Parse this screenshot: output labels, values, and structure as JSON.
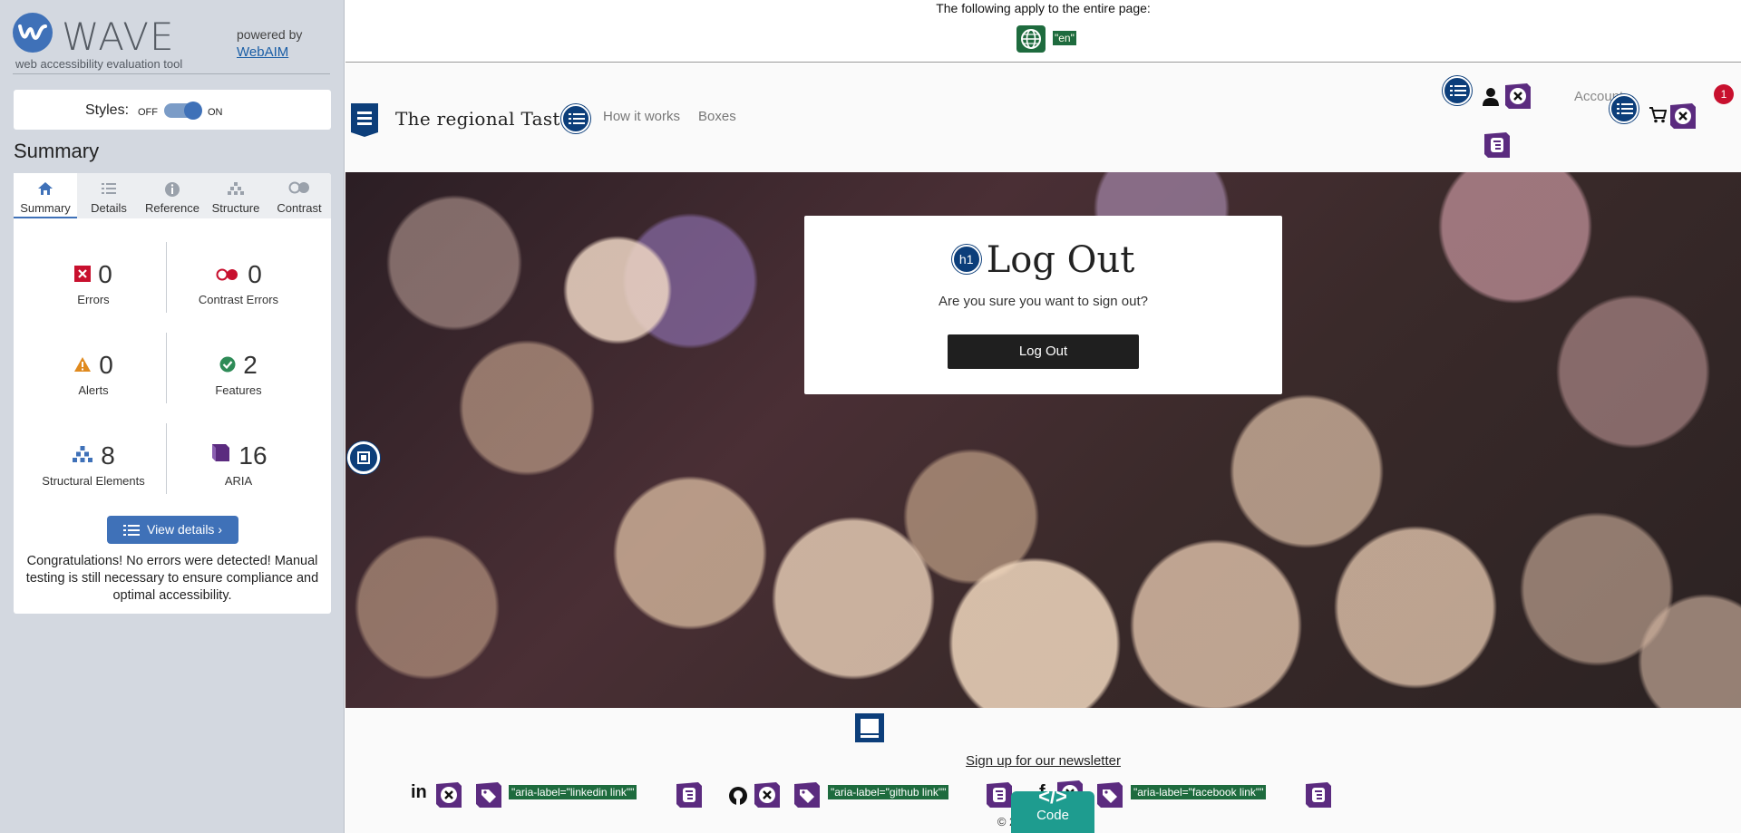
{
  "wave": {
    "brand_name": "WAVE",
    "tagline": "web accessibility evaluation tool",
    "powered_by": "powered by",
    "webaim_link": "WebAIM",
    "styles_label": "Styles:",
    "styles_off": "OFF",
    "styles_on": "ON",
    "summary_heading": "Summary",
    "tabs": [
      "Summary",
      "Details",
      "Reference",
      "Structure",
      "Contrast"
    ],
    "active_tab": "Summary",
    "stats": {
      "errors": {
        "count": "0",
        "label": "Errors"
      },
      "contrast_errors": {
        "count": "0",
        "label": "Contrast Errors"
      },
      "alerts": {
        "count": "0",
        "label": "Alerts"
      },
      "features": {
        "count": "2",
        "label": "Features"
      },
      "structural": {
        "count": "8",
        "label": "Structural Elements"
      },
      "aria": {
        "count": "16",
        "label": "ARIA"
      }
    },
    "view_details": "View details ›",
    "congrats": "Congratulations! No errors were detected! Manual testing is still necessary to ensure compliance and optimal accessibility."
  },
  "page": {
    "apply_text": "The following apply to the entire page:",
    "lang_tag": "\"en\"",
    "site_name": "The regional Taste",
    "nav": [
      "How it works",
      "Boxes"
    ],
    "account_label": "Account",
    "cart_badge": "1",
    "modal": {
      "h1_badge": "h1",
      "title": "Log Out",
      "question": "Are you sure you want to sign out?",
      "button": "Log Out"
    },
    "footer": {
      "newsletter": "Sign up for our newsletter",
      "linkedin_label": "\"aria-label=\"linkedin link\"\"",
      "github_label": "\"aria-label=\"github link\"\"",
      "facebook_label": "\"aria-label=\"facebook link\"\"",
      "copyright": "© 2021 Copyright",
      "code_button": "Code",
      "code_glyph": "</>"
    }
  },
  "colors": {
    "wave_blue": "#3f71b8",
    "aria_purple": "#5b2b7f",
    "feature_green": "#1e6b3e",
    "structure_navy": "#0c3e7a",
    "error_red": "#c8102e",
    "code_teal": "#1e9c8f"
  },
  "icons": [
    "wave-logo-icon",
    "home-icon",
    "list-icon",
    "info-icon",
    "structure-icon",
    "contrast-icon",
    "error-icon",
    "contrast-error-icon",
    "alert-icon",
    "feature-icon",
    "structural-icon",
    "aria-icon",
    "globe-icon",
    "user-icon",
    "cart-icon",
    "linkedin-icon",
    "github-icon",
    "facebook-icon",
    "tag-icon",
    "hand-icon",
    "close-icon"
  ]
}
